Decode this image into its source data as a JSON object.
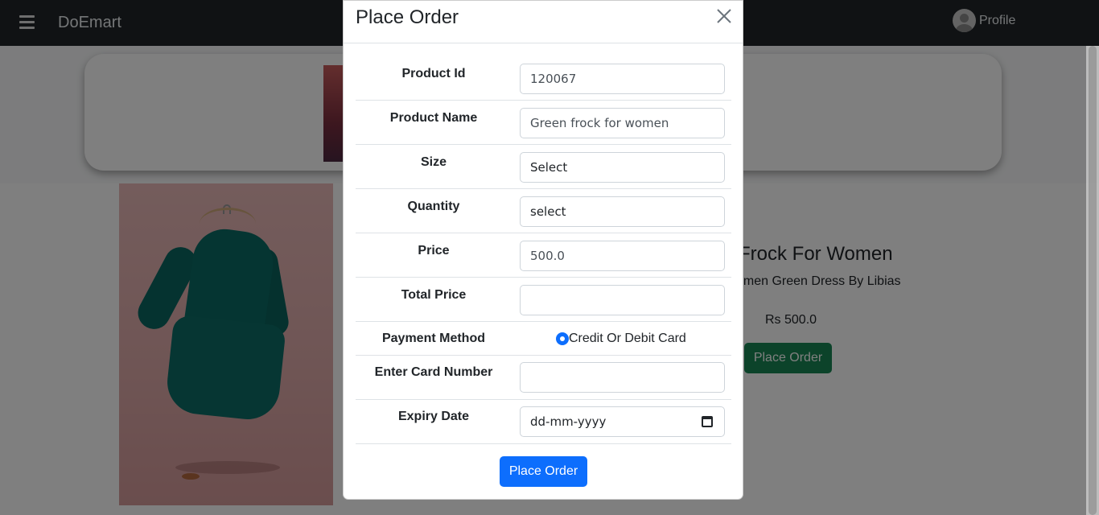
{
  "navbar": {
    "brand": "DoEmart",
    "profile_label": "Profile"
  },
  "product": {
    "title": "Frock For Women",
    "subtitle": "omen Green Dress By Libias",
    "price": "Rs 500.0",
    "order_button": "Place Order"
  },
  "modal": {
    "title": "Place Order",
    "fields": {
      "product_id": {
        "label": "Product Id",
        "value": "120067"
      },
      "product_name": {
        "label": "Product Name",
        "value": "Green frock  for women"
      },
      "size": {
        "label": "Size",
        "value": "Select"
      },
      "quantity": {
        "label": "Quantity",
        "value": "select"
      },
      "price": {
        "label": "Price",
        "value": "500.0"
      },
      "total_price": {
        "label": "Total Price",
        "value": ""
      },
      "payment_method": {
        "label": "Payment Method",
        "option": "Credit Or Debit Card"
      },
      "card_number": {
        "label": "Enter Card Number",
        "value": ""
      },
      "expiry_date": {
        "label": "Expiry Date",
        "placeholder": "dd-mm-yyyy"
      }
    },
    "submit_label": "Place Order"
  },
  "colors": {
    "navbar": "#212529",
    "primary": "#0d6efd",
    "success": "#198754"
  }
}
